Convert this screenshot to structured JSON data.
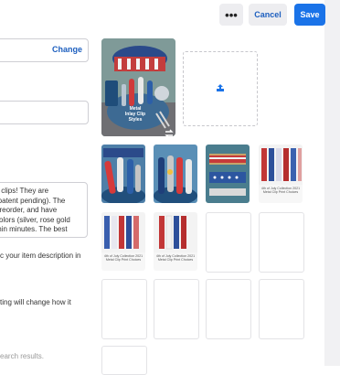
{
  "toolbar": {
    "more_label": "•••",
    "cancel_label": "Cancel",
    "save_label": "Save"
  },
  "left_column": {
    "change_label": "Change",
    "description_text": "y clips! They are\n(patent pending). The\npreorder, and have\ncolors (silver, rose gold\nthin minutes. The best",
    "hint_1": "c your item description in",
    "hint_2": "ting will change how it",
    "search_hint": "earch results."
  },
  "photos": {
    "main_caption": "Metal\nInlay Clip\nStyles",
    "print_caption_1": "4th of July Collection 2021\nMetal Clip Print Choices",
    "print_caption_2": "4th of July Collection 2021\nMetal Clip Print Choices",
    "print_caption_3": "4th of July Collection 2021\nMetal Clip Print Choices"
  },
  "colors": {
    "accent": "#1a73e8",
    "link": "#1d5fbf"
  }
}
